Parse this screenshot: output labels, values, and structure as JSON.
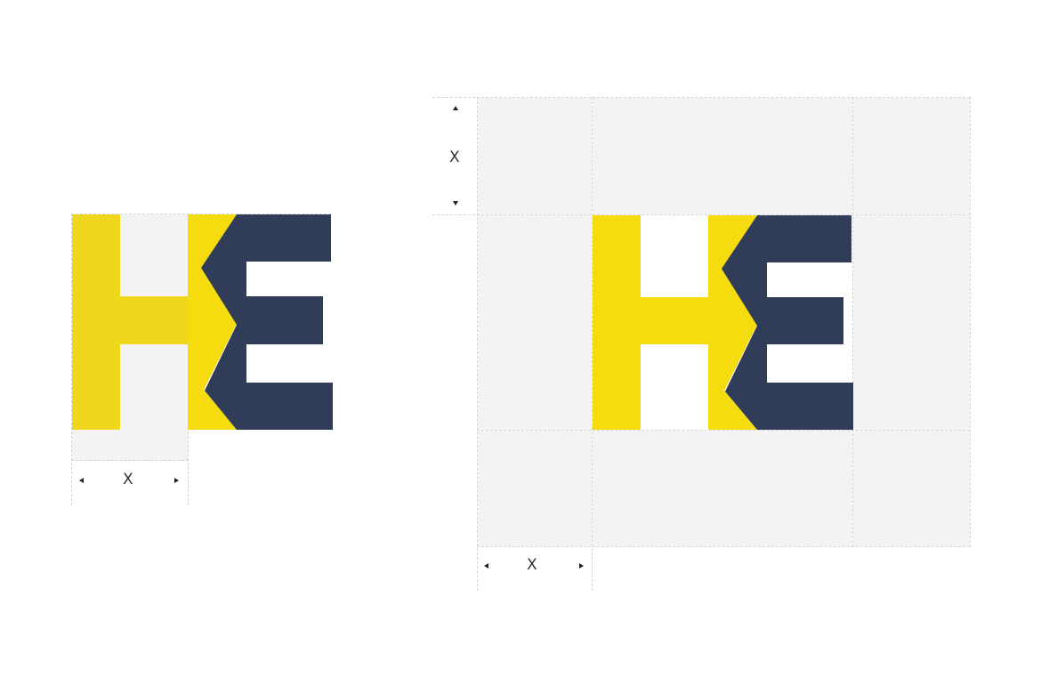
{
  "colors": {
    "yellow_left": "#EFD71E",
    "yellow_right": "#F5DC0E",
    "navy": "#313C58",
    "grid_fill": "#F3F3F3",
    "dash": "#D4D4D4"
  },
  "left_example": {
    "dimension_label": "X"
  },
  "right_example": {
    "vertical_dimension_label": "X",
    "horizontal_dimension_label": "X"
  }
}
